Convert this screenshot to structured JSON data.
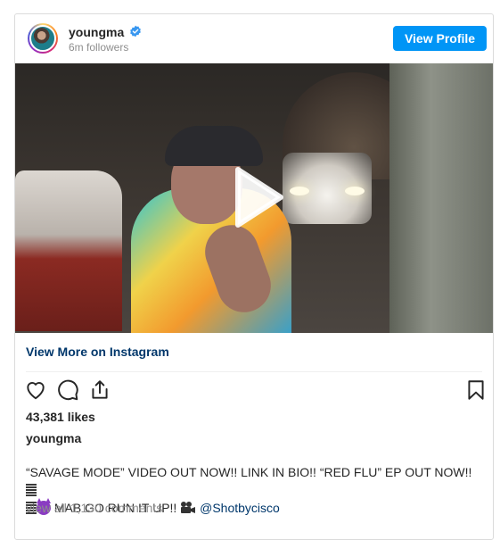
{
  "header": {
    "username": "youngma",
    "followers": "6m followers",
    "view_profile_label": "View Profile"
  },
  "media": {
    "type": "video",
    "play_icon": "play-icon"
  },
  "link": {
    "view_more_label": "View More on Instagram"
  },
  "actions": {
    "icons": [
      "heart-icon",
      "comment-icon",
      "share-icon",
      "bookmark-icon"
    ]
  },
  "post": {
    "likes": "43,381 likes",
    "caption_username": "youngma",
    "caption_line1": "“SAVAGE MODE” VIDEO OUT NOW!! LINK IN BIO!! “RED FLU” EP OUT NOW!!",
    "caption_line2": "MAB GO RUN IT UP!!",
    "mention": "@Shotbycisco",
    "view_comments": "view all 1,130 comments"
  },
  "colors": {
    "accent": "#0095f6",
    "link": "#00376b",
    "muted": "#8e8e8e",
    "text": "#262626"
  }
}
